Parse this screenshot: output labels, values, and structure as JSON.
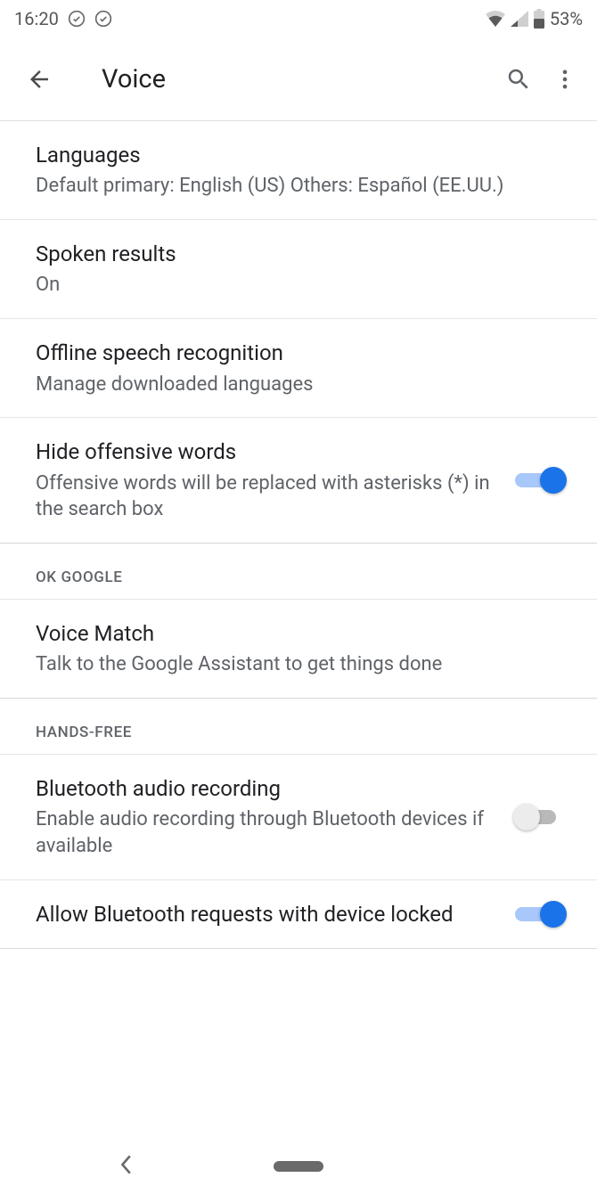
{
  "status": {
    "time": "16:20",
    "battery": "53%"
  },
  "appbar": {
    "title": "Voice"
  },
  "items": {
    "languages": {
      "title": "Languages",
      "subtitle": "Default primary: English (US) Others: Español (EE.UU.)"
    },
    "spoken": {
      "title": "Spoken results",
      "subtitle": "On"
    },
    "offline": {
      "title": "Offline speech recognition",
      "subtitle": "Manage downloaded languages"
    },
    "hide_offensive": {
      "title": "Hide offensive words",
      "subtitle": "Offensive words will be replaced with asterisks (*) in the search box"
    },
    "voice_match": {
      "title": "Voice Match",
      "subtitle": "Talk to the Google Assistant to get things done"
    },
    "bt_audio": {
      "title": "Bluetooth audio recording",
      "subtitle": "Enable audio recording through Bluetooth devices if available"
    },
    "bt_locked": {
      "title": "Allow Bluetooth requests with device locked"
    }
  },
  "sections": {
    "ok_google": "OK GOOGLE",
    "hands_free": "HANDS-FREE"
  }
}
